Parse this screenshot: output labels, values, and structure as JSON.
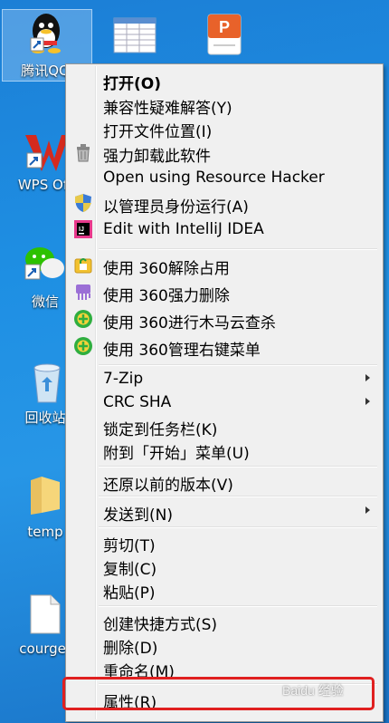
{
  "desktop": {
    "icons": [
      {
        "label": "腾讯QQ",
        "icon": "qq-icon"
      },
      {
        "label": "",
        "icon": "spreadsheet-icon"
      },
      {
        "label": "",
        "icon": "presentation-icon"
      },
      {
        "label": "WPS Off",
        "icon": "wps-icon"
      },
      {
        "label": "微信",
        "icon": "wechat-icon"
      },
      {
        "label": "回收站",
        "icon": "recycle-bin-icon"
      },
      {
        "label": "temp",
        "icon": "folder-icon"
      },
      {
        "label": "courget",
        "icon": "file-icon"
      }
    ]
  },
  "menu": {
    "open": "打开(O)",
    "compat": "兼容性疑难解答(Y)",
    "open_location": "打开文件位置(I)",
    "force_uninstall": "强力卸载此软件",
    "resource_hacker": "Open using Resource Hacker",
    "run_admin": "以管理员身份运行(A)",
    "intellij": "Edit with IntelliJ IDEA",
    "unlock360": "使用 360解除占用",
    "delete360": "使用 360强力删除",
    "scan360": "使用 360进行木马云查杀",
    "rightmenu360": "使用 360管理右键菜单",
    "zip": "7-Zip",
    "crc": "CRC SHA",
    "pin_taskbar": "锁定到任务栏(K)",
    "pin_start": "附到「开始」菜单(U)",
    "restore": "还原以前的版本(V)",
    "send_to": "发送到(N)",
    "cut": "剪切(T)",
    "copy": "复制(C)",
    "paste": "粘贴(P)",
    "shortcut": "创建快捷方式(S)",
    "delete": "删除(D)",
    "rename": "重命名(M)",
    "properties": "属性(R)"
  },
  "colors": {
    "highlight_border": "#e02020",
    "desktop": "#1e8fe3"
  },
  "watermark": "Baidu 经验"
}
